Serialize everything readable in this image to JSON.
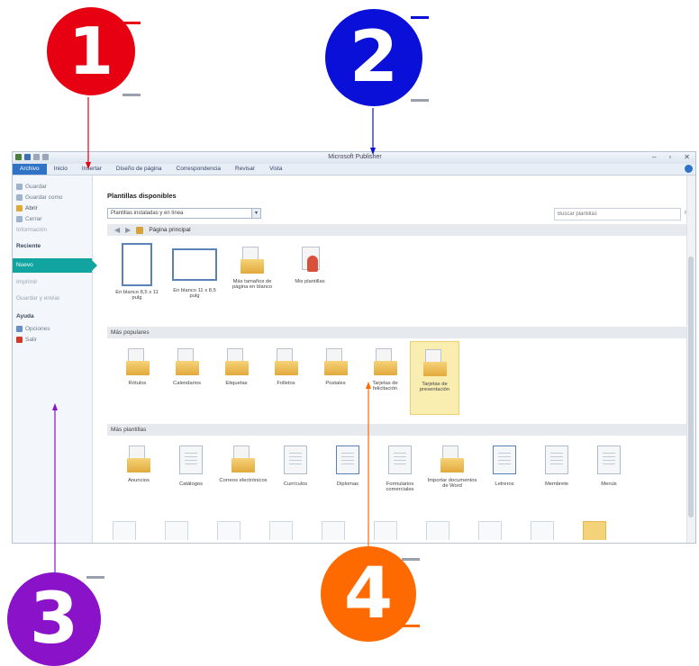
{
  "callouts": [
    "1",
    "2",
    "3",
    "4"
  ],
  "window": {
    "title": "Microsoft Publisher",
    "controls": [
      "–",
      "▫",
      "✕"
    ]
  },
  "ribbon": {
    "tabs": [
      "Archivo",
      "Inicio",
      "Insertar",
      "Diseño de página",
      "Correspondencia",
      "Revisar",
      "Vista"
    ]
  },
  "sidebar": {
    "items": [
      "Guardar",
      "Guardar como",
      "Abrir",
      "Cerrar"
    ],
    "info": "Información",
    "recent": "Reciente",
    "new": "Nuevo",
    "print": "Imprimir",
    "share": "Guardar y enviar",
    "help": "Ayuda",
    "options": "Opciones",
    "exit": "Salir"
  },
  "main": {
    "title": "Plantillas disponibles",
    "dropdown_value": "Plantillas instaladas y en línea",
    "search_placeholder": "Buscar plantillas",
    "home_label": "Página principal",
    "blank_items": [
      "En blanco 8,5 x 11 pulg",
      "En blanco 11 x 8,5 pulg",
      "Más tamaños de página en blanco",
      "Mis plantillas"
    ],
    "popular_header": "Más populares",
    "popular": [
      "Rótulos",
      "Calendarios",
      "Etiquetas",
      "Folletos",
      "Postales",
      "Tarjetas de felicitación",
      "Tarjetas de presentación"
    ],
    "more_header": "Más plantillas",
    "more": [
      "Anuncios",
      "Catálogos",
      "Correos electrónicos",
      "Currículos",
      "Diplomas",
      "Formularios comerciales",
      "Importar documentos de Word",
      "Letreros",
      "Membrete",
      "Menús"
    ]
  },
  "colors": {
    "callout1": "#e60012",
    "callout2": "#0a10d8",
    "callout3": "#8a12c8",
    "callout4": "#ff6a00",
    "accent": "#12a4a0"
  }
}
